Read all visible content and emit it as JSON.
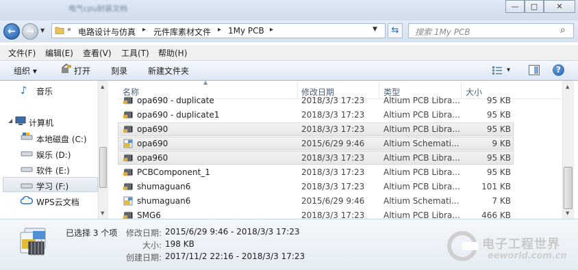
{
  "window": {
    "blurred_title": "电气cpu封装文档",
    "controls": {
      "minimize": "—",
      "maximize": "□",
      "close": "✕"
    }
  },
  "address": {
    "overflow": "«",
    "crumbs": [
      "电路设计与仿真",
      "元件库素材文件",
      "1My PCB"
    ],
    "separator": "▸"
  },
  "search": {
    "placeholder": "搜索 1My PCB"
  },
  "menu": [
    "文件(F)",
    "编辑(E)",
    "查看(V)",
    "工具(T)",
    "帮助(H)"
  ],
  "toolbar": {
    "organize": "组织 ▾",
    "open": "打开",
    "burn": "刻录",
    "new_folder": "新建文件夹",
    "view_menu": "▾"
  },
  "nav": {
    "music": "音乐",
    "computer": "计算机",
    "drives": [
      "本地磁盘 (C:)",
      "娱乐 (D:)",
      "软件 (E:)",
      "学习 (F:)"
    ],
    "wps": "WPS云文档"
  },
  "columns": {
    "name": "名称",
    "date": "修改日期",
    "type": "类型",
    "size": "大小"
  },
  "files": [
    {
      "name": "opa690 - duplicate",
      "date": "2018/3/3 17:23",
      "type": "Altium PCB Libra...",
      "size": "95 KB",
      "icon": "pcb-library-icon",
      "selected": false
    },
    {
      "name": "opa690 - duplicate1",
      "date": "2018/3/3 17:23",
      "type": "Altium PCB Libra...",
      "size": "95 KB",
      "icon": "pcb-library-icon",
      "selected": false
    },
    {
      "name": "opa690",
      "date": "2018/3/3 17:23",
      "type": "Altium PCB Libra...",
      "size": "95 KB",
      "icon": "pcb-library-icon",
      "selected": true
    },
    {
      "name": "opa690",
      "date": "2015/6/29 9:46",
      "type": "Altium Schemati...",
      "size": "9 KB",
      "icon": "schematic-library-icon",
      "selected": true
    },
    {
      "name": "opa960",
      "date": "2018/3/3 17:23",
      "type": "Altium PCB Libra...",
      "size": "95 KB",
      "icon": "pcb-library-icon",
      "selected": true
    },
    {
      "name": "PCBComponent_1",
      "date": "2018/3/3 17:23",
      "type": "Altium PCB Libra...",
      "size": "95 KB",
      "icon": "pcb-library-icon",
      "selected": false
    },
    {
      "name": "shumaguan6",
      "date": "2018/3/3 17:23",
      "type": "Altium PCB Libra...",
      "size": "101 KB",
      "icon": "pcb-library-icon",
      "selected": false
    },
    {
      "name": "shumaguan6",
      "date": "2015/6/29 9:46",
      "type": "Altium Schemati...",
      "size": "7 KB",
      "icon": "schematic-library-icon",
      "selected": false
    },
    {
      "name": "SMG6",
      "date": "2018/3/3 17:23",
      "type": "Altium PCB Libra...",
      "size": "466 KB",
      "icon": "pcb-library-icon",
      "selected": false
    }
  ],
  "details": {
    "selection": "已选择 3 个项",
    "modified_label": "修改日期:",
    "modified_value": "2015/6/29 9:46 - 2018/3/3 17:23",
    "size_label": "大小:",
    "size_value": "198 KB",
    "created_label": "创建日期:",
    "created_value": "2017/11/2 22:16 - 2018/3/3 17:23"
  },
  "watermark": {
    "cn": "电子工程世界",
    "en": "eeworld.com.cn"
  },
  "colors": {
    "selection": "#e8e8e8",
    "link": "#1d5aa6",
    "watermark": "#c9c9c9"
  }
}
